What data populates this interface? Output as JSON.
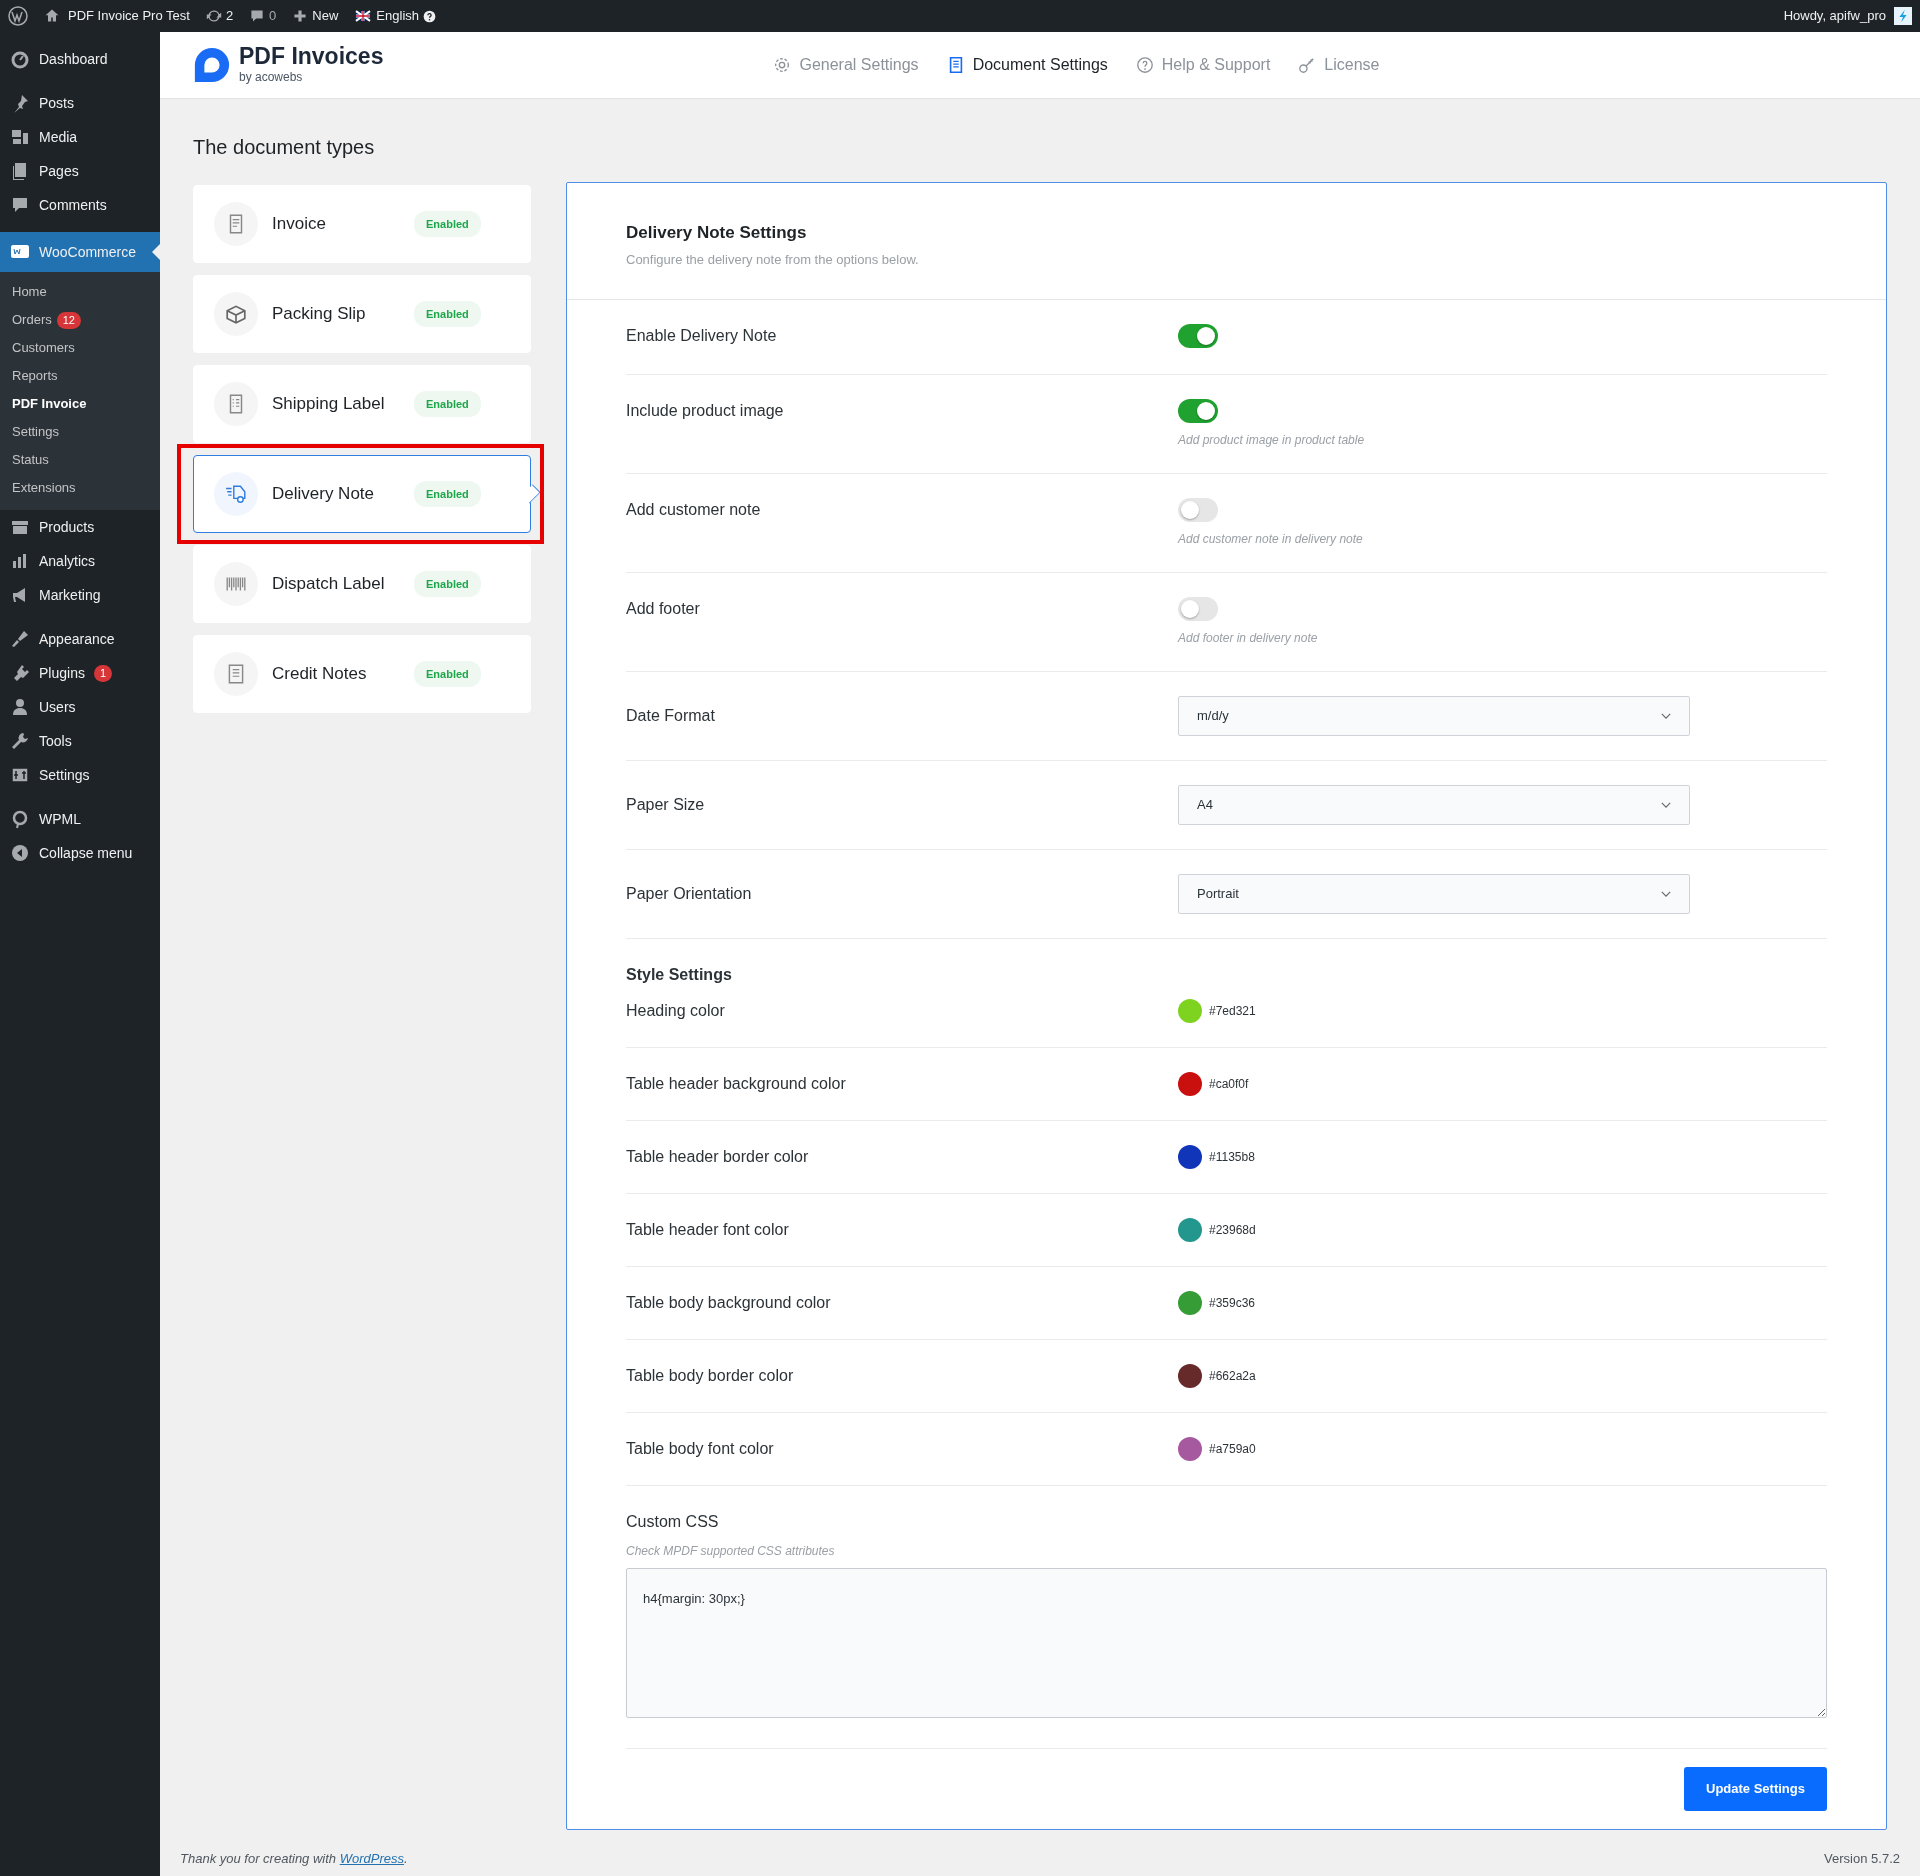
{
  "admin_bar": {
    "site": "PDF Invoice Pro Test",
    "updates": "2",
    "comments": "0",
    "new": "New",
    "language": "English",
    "greeting": "Howdy, apifw_pro"
  },
  "sidebar": {
    "groups": [
      [
        {
          "label": "Dashboard",
          "selected": false
        }
      ],
      [
        {
          "label": "Posts",
          "selected": false
        },
        {
          "label": "Media",
          "selected": false
        },
        {
          "label": "Pages",
          "selected": false
        },
        {
          "label": "Comments",
          "selected": false
        }
      ],
      [
        {
          "label": "WooCommerce",
          "selected": true,
          "children": [
            {
              "label": "Home",
              "selected": false
            },
            {
              "label": "Orders",
              "badge": "12",
              "selected": false
            },
            {
              "label": "Customers",
              "selected": false
            },
            {
              "label": "Reports",
              "selected": false
            },
            {
              "label": "PDF Invoice",
              "selected": true
            },
            {
              "label": "Settings",
              "selected": false
            },
            {
              "label": "Status",
              "selected": false
            },
            {
              "label": "Extensions",
              "selected": false
            }
          ]
        },
        {
          "label": "Products",
          "selected": false
        },
        {
          "label": "Analytics",
          "selected": false
        },
        {
          "label": "Marketing",
          "selected": false
        }
      ],
      [
        {
          "label": "Appearance",
          "selected": false
        },
        {
          "label": "Plugins",
          "badge": "1",
          "selected": false
        },
        {
          "label": "Users",
          "selected": false
        },
        {
          "label": "Tools",
          "selected": false
        },
        {
          "label": "Settings",
          "selected": false
        }
      ],
      [
        {
          "label": "WPML",
          "selected": false
        },
        {
          "label": "Collapse menu",
          "selected": false
        }
      ]
    ]
  },
  "header": {
    "logo_title": "PDF Invoices",
    "logo_subtitle": "by acowebs",
    "tabs": [
      {
        "label": "General Settings",
        "selected": false
      },
      {
        "label": "Document Settings",
        "selected": true
      },
      {
        "label": "Help & Support",
        "selected": false
      },
      {
        "label": "License",
        "selected": false
      }
    ]
  },
  "document_types": {
    "title": "The document types",
    "items": [
      {
        "label": "Invoice",
        "status": "Enabled",
        "selected": false,
        "highlighted": false
      },
      {
        "label": "Packing Slip",
        "status": "Enabled",
        "selected": false,
        "highlighted": false
      },
      {
        "label": "Shipping Label",
        "status": "Enabled",
        "selected": false,
        "highlighted": false
      },
      {
        "label": "Delivery Note",
        "status": "Enabled",
        "selected": true,
        "highlighted": true
      },
      {
        "label": "Dispatch Label",
        "status": "Enabled",
        "selected": false,
        "highlighted": false
      },
      {
        "label": "Credit Notes",
        "status": "Enabled",
        "selected": false,
        "highlighted": false
      }
    ]
  },
  "settings_panel": {
    "title": "Delivery Note Settings",
    "subtitle": "Configure the delivery note from the options below.",
    "rows": [
      {
        "kind": "toggle",
        "label": "Enable Delivery Note",
        "on": true
      },
      {
        "kind": "toggle",
        "label": "Include product image",
        "on": true,
        "hint": "Add product image in product table"
      },
      {
        "kind": "toggle",
        "label": "Add customer note",
        "on": false,
        "hint": "Add customer note in delivery note"
      },
      {
        "kind": "toggle",
        "label": "Add footer",
        "on": false,
        "hint": "Add footer in delivery note"
      },
      {
        "kind": "select",
        "label": "Date Format",
        "value": "m/d/y"
      },
      {
        "kind": "select",
        "label": "Paper Size",
        "value": "A4"
      },
      {
        "kind": "select",
        "label": "Paper Orientation",
        "value": "Portrait"
      },
      {
        "kind": "heading",
        "label": "Style Settings"
      },
      {
        "kind": "color",
        "label": "Heading color",
        "color": "#7ed321",
        "value": "#7ed321"
      },
      {
        "kind": "color",
        "label": "Table header background color",
        "color": "#ca0f0f",
        "value": "#ca0f0f"
      },
      {
        "kind": "color",
        "label": "Table header border color",
        "color": "#1135b8",
        "value": "#1135b8"
      },
      {
        "kind": "color",
        "label": "Table header font color",
        "color": "#23968d",
        "value": "#23968d"
      },
      {
        "kind": "color",
        "label": "Table body background color",
        "color": "#359c36",
        "value": "#359c36"
      },
      {
        "kind": "color",
        "label": "Table body border color",
        "color": "#662a2a",
        "value": "#662a2a"
      },
      {
        "kind": "color",
        "label": "Table body font color",
        "color": "#a759a0",
        "value": "#a759a0"
      },
      {
        "kind": "textarea",
        "label": "Custom CSS",
        "hint": "Check MPDF supported CSS attributes",
        "value": "h4{margin: 30px;}"
      }
    ],
    "button": "Update Settings"
  },
  "footer": {
    "thanks": "Thank you for creating with",
    "link": "WordPress",
    "after": ".",
    "version": "Version 5.7.2"
  }
}
